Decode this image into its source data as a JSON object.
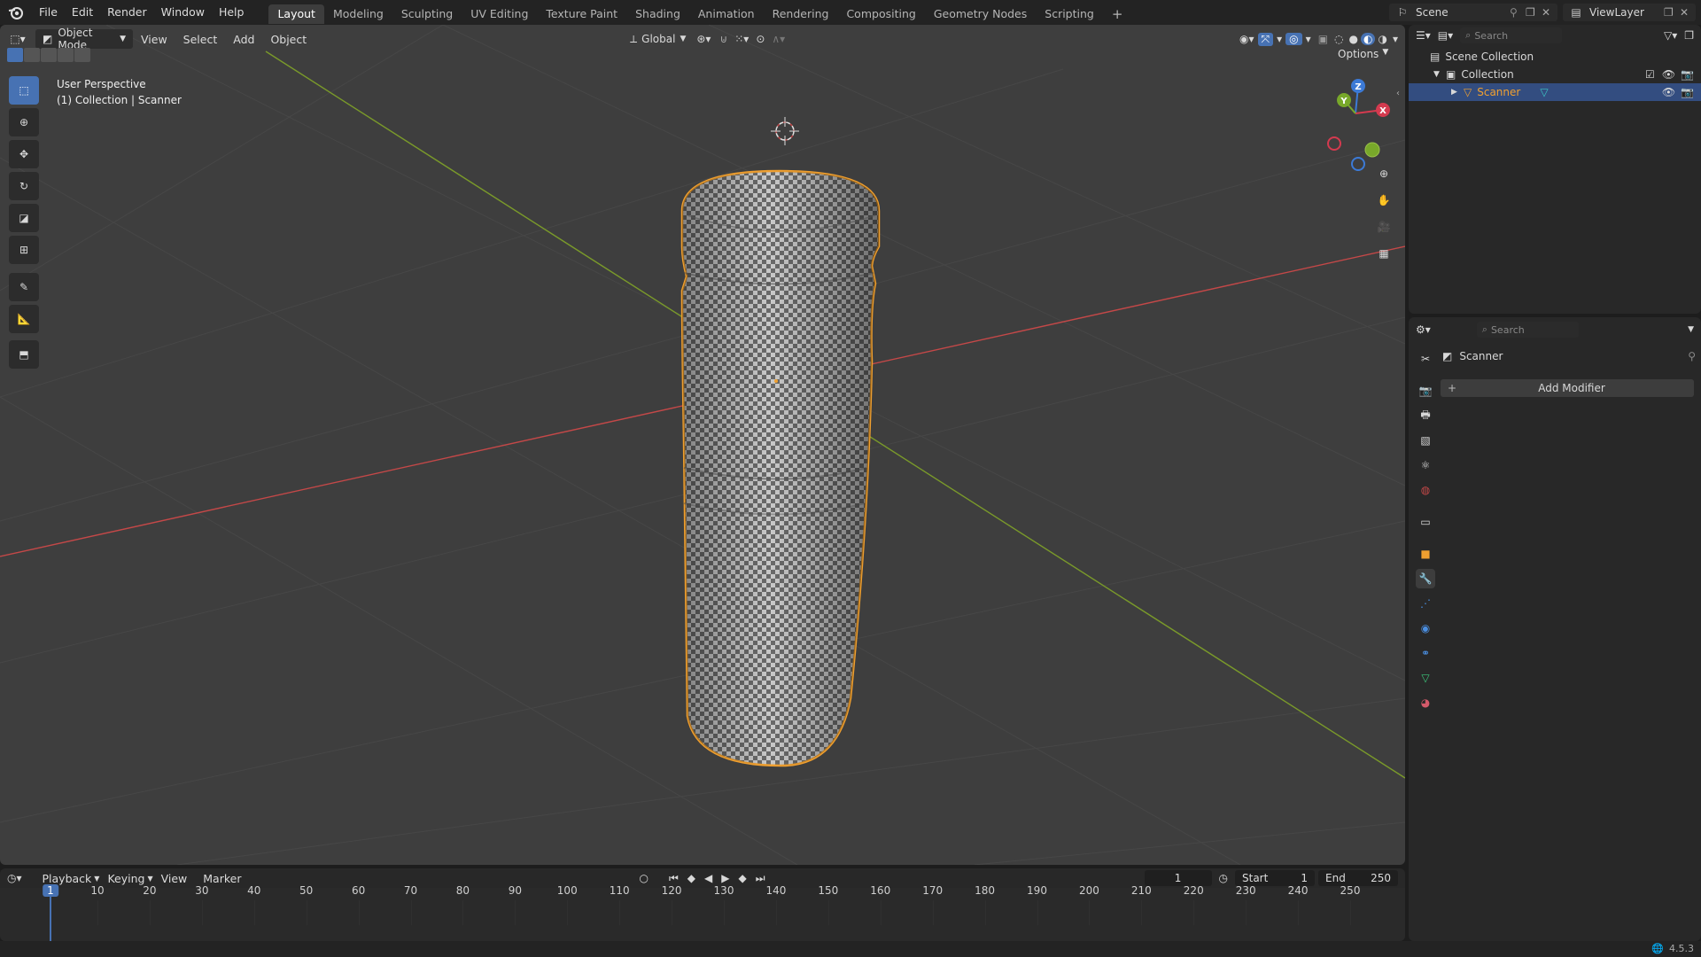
{
  "menubar": {
    "items": [
      "File",
      "Edit",
      "Render",
      "Window",
      "Help"
    ]
  },
  "workspaces": {
    "tabs": [
      "Layout",
      "Modeling",
      "Sculpting",
      "UV Editing",
      "Texture Paint",
      "Shading",
      "Animation",
      "Rendering",
      "Compositing",
      "Geometry Nodes",
      "Scripting"
    ],
    "active": "Layout",
    "add_label": "+"
  },
  "scene": {
    "name": "Scene",
    "view_layer": "ViewLayer"
  },
  "viewport": {
    "mode": "Object Mode",
    "menus": [
      "View",
      "Select",
      "Add",
      "Object"
    ],
    "transform_orientation": "Global",
    "options_label": "Options",
    "overlay_line1": "User Perspective",
    "overlay_line2": "(1) Collection | Scanner",
    "gizmo_axes": {
      "x": "X",
      "y": "Y",
      "z": "Z"
    }
  },
  "outliner": {
    "search_placeholder": "Search",
    "root": "Scene Collection",
    "collection": "Collection",
    "object": "Scanner"
  },
  "properties": {
    "search_placeholder": "Search",
    "object_name": "Scanner",
    "add_modifier_label": "Add Modifier"
  },
  "timeline": {
    "menus": [
      "Playback",
      "Keying",
      "View",
      "Marker"
    ],
    "current_frame": "1",
    "start_label": "Start",
    "start_value": "1",
    "end_label": "End",
    "end_value": "250",
    "ticks": [
      "1",
      "10",
      "20",
      "30",
      "40",
      "50",
      "60",
      "70",
      "80",
      "90",
      "100",
      "110",
      "120",
      "130",
      "140",
      "150",
      "160",
      "170",
      "180",
      "190",
      "200",
      "210",
      "220",
      "230",
      "240",
      "250"
    ]
  },
  "statusbar": {
    "version": "4.5.3"
  },
  "colors": {
    "accent": "#4772b3",
    "selection": "#f0a030",
    "x_axis": "#c44848",
    "y_axis": "#7a9a2a",
    "gizmo_x": "#d43a4f",
    "gizmo_y": "#78a82a",
    "gizmo_z": "#3c7ad6"
  }
}
